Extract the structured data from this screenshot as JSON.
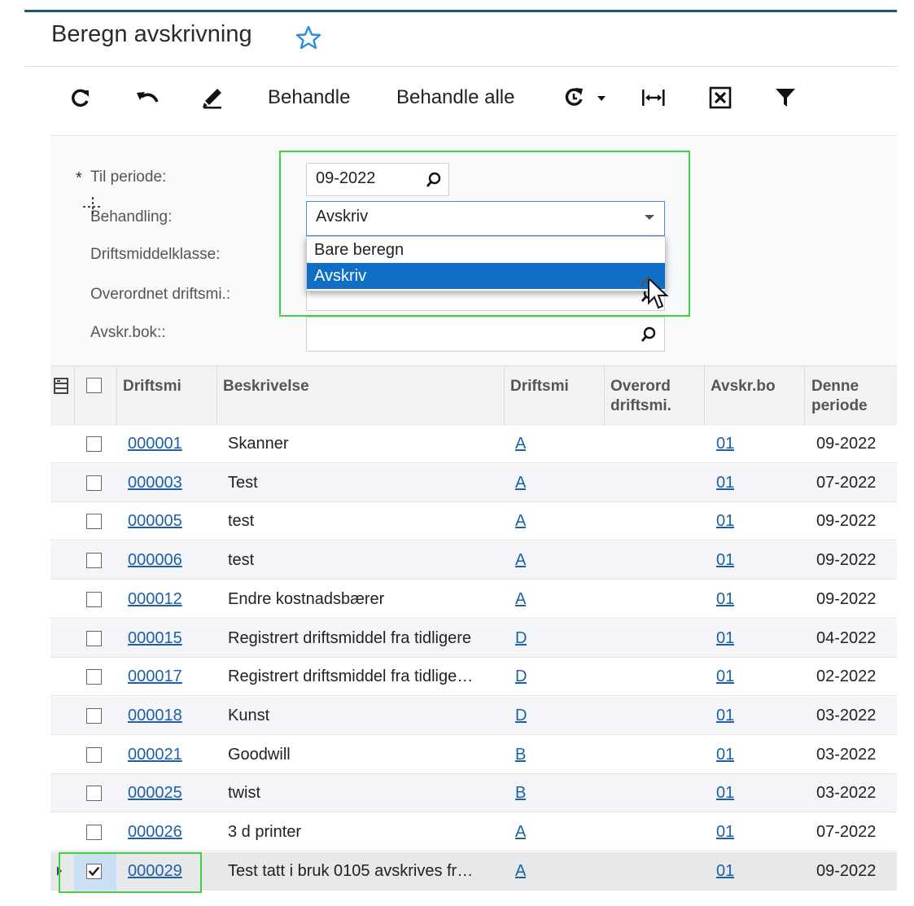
{
  "page": {
    "title": "Beregn avskrivning"
  },
  "toolbar": {
    "process_label": "Behandle",
    "process_all_label": "Behandle alle"
  },
  "filters": {
    "period_label": "Til periode:",
    "period_value": "09-2022",
    "action_label": "Behandling:",
    "action_value": "Avskriv",
    "class_label": "Driftsmiddelklasse:",
    "parent_label": "Overordnet driftsmi.:",
    "book_label": "Avskr.bok::",
    "action_options": [
      "Bare beregn",
      "Avskriv"
    ],
    "required_mark": "*"
  },
  "grid": {
    "columns": [
      "Driftsmi",
      "Beskrivelse",
      "Driftsmi",
      "Overord driftsmi.",
      "Avskr.bo",
      "Denne periode"
    ],
    "rows": [
      {
        "id": "000001",
        "desc": "Skanner",
        "cls": "A",
        "book": "01",
        "period": "09-2022",
        "checked": false
      },
      {
        "id": "000003",
        "desc": "Test",
        "cls": "A",
        "book": "01",
        "period": "07-2022",
        "checked": false
      },
      {
        "id": "000005",
        "desc": "test",
        "cls": "A",
        "book": "01",
        "period": "09-2022",
        "checked": false
      },
      {
        "id": "000006",
        "desc": "test",
        "cls": "A",
        "book": "01",
        "period": "09-2022",
        "checked": false
      },
      {
        "id": "000012",
        "desc": "Endre kostnadsbærer",
        "cls": "A",
        "book": "01",
        "period": "09-2022",
        "checked": false
      },
      {
        "id": "000015",
        "desc": "Registrert driftsmiddel fra tidligere",
        "cls": "D",
        "book": "01",
        "period": "04-2022",
        "checked": false
      },
      {
        "id": "000017",
        "desc": "Registrert driftsmiddel fra tidlige…",
        "cls": "D",
        "book": "01",
        "period": "02-2022",
        "checked": false
      },
      {
        "id": "000018",
        "desc": "Kunst",
        "cls": "D",
        "book": "01",
        "period": "03-2022",
        "checked": false
      },
      {
        "id": "000021",
        "desc": "Goodwill",
        "cls": "B",
        "book": "01",
        "period": "03-2022",
        "checked": false
      },
      {
        "id": "000025",
        "desc": "twist",
        "cls": "B",
        "book": "01",
        "period": "03-2022",
        "checked": false
      },
      {
        "id": "000026",
        "desc": "3 d printer",
        "cls": "A",
        "book": "01",
        "period": "07-2022",
        "checked": false
      },
      {
        "id": "000029",
        "desc": "Test tatt i bruk 0105 avskrives fr…",
        "cls": "A",
        "book": "01",
        "period": "09-2022",
        "checked": true
      }
    ]
  },
  "colors": {
    "accent": "#0f6fc6",
    "link": "#1f5fa6",
    "highlight": "#3ed23e",
    "title_bar": "#1c5a7a"
  }
}
